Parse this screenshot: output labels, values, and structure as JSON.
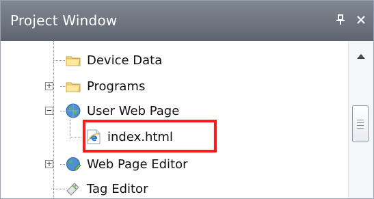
{
  "panel": {
    "title": "Project Window",
    "pin_icon": "pin-icon",
    "close_icon": "close-icon"
  },
  "tree": {
    "items": [
      {
        "label": "Device Data",
        "icon": "folder-icon"
      },
      {
        "label": "Programs",
        "icon": "folder-icon",
        "expander": "+"
      },
      {
        "label": "User Web Page",
        "icon": "globe-icon",
        "expander": "−"
      },
      {
        "label": "index.html",
        "icon": "ie-page-icon",
        "selected_highlight": true
      },
      {
        "label": "Web Page Editor",
        "icon": "web-editor-icon",
        "expander": "+"
      },
      {
        "label": "Tag Editor",
        "icon": "tag-editor-icon"
      }
    ]
  },
  "colors": {
    "title_bar": "#6f7781",
    "highlight_border": "#ff1a1a"
  }
}
